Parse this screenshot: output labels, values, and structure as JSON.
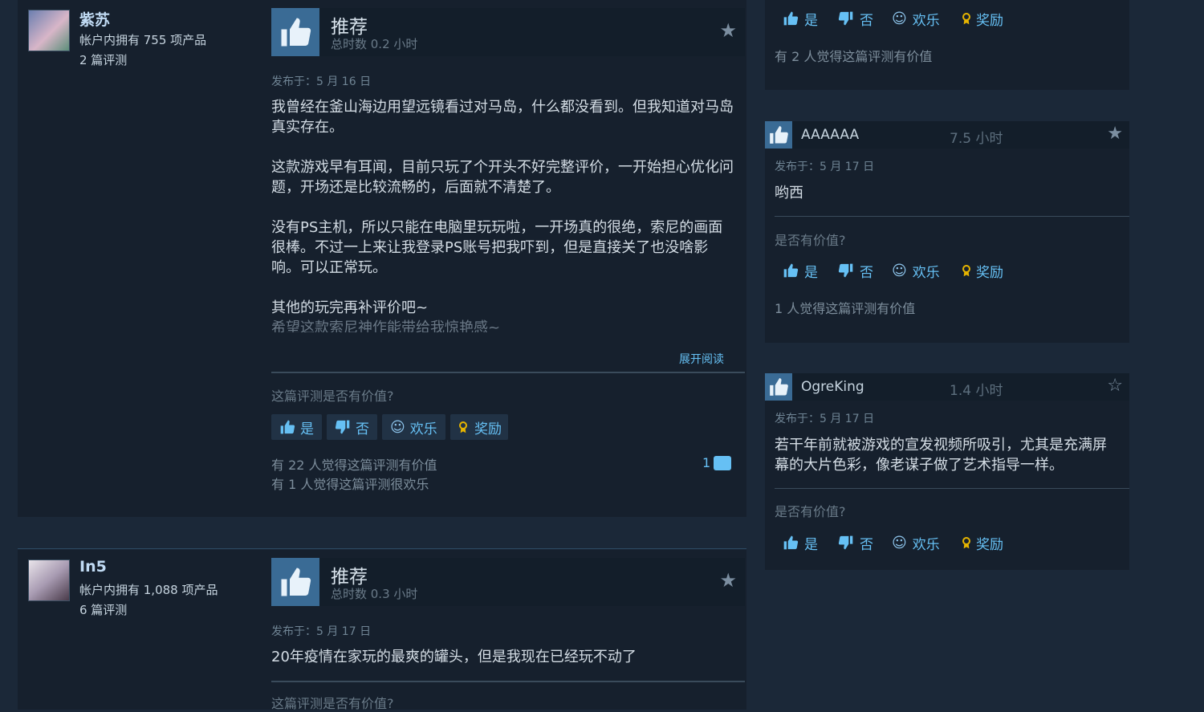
{
  "colors": {
    "accent": "#66c0f4",
    "background": "#1b2838",
    "card": "#16202d",
    "thumb": "#3a6b95"
  },
  "icons": {
    "thumbs_up": "thumbs-up-icon",
    "thumbs_down": "thumbs-down-icon",
    "funny": "smiley-icon",
    "award": "award-icon",
    "star": "star-icon",
    "comment": "comment-icon"
  },
  "review1": {
    "user": {
      "name": "紫苏",
      "products": "帐户内拥有 755 项产品",
      "reviews": "2 篇评测"
    },
    "title": "推荐",
    "hours": "总时数 0.2 小时",
    "posted": "发布于：5 月 16 日",
    "paragraphs": [
      "我曾经在釜山海边用望远镜看过对马岛，什么都没看到。但我知道对马岛真实存在。",
      "这款游戏早有耳闻，目前只玩了个开头不好完整评价，一开始担心优化问题，开场还是比较流畅的，后面就不清楚了。",
      "没有PS主机，所以只能在电脑里玩玩啦，一开场真的很绝，索尼的画面很棒。不过一上来让我登录PS账号把我吓到，但是直接关了也没啥影响。可以正常玩。",
      "其他的玩完再补评价吧~"
    ],
    "faded_line": "希望这款索尼神作能带给我惊艳感~",
    "expand": "展开阅读",
    "question": "这篇评测是否有价值?",
    "btn_yes": "是",
    "btn_no": "否",
    "btn_funny": "欢乐",
    "btn_award": "奖励",
    "helpful": "有 22 人觉得这篇评测有价值",
    "funny": "有 1 人觉得这篇评测很欢乐",
    "comments": "1"
  },
  "review2": {
    "user": {
      "name": "In5",
      "products": "帐户内拥有 1,088 项产品",
      "reviews": "6 篇评测"
    },
    "title": "推荐",
    "hours": "总时数 0.3 小时",
    "posted": "发布于：5 月 17 日",
    "text": "20年疫情在家玩的最爽的罐头，但是我现在已经玩不动了",
    "question": "这篇评测是否有价值?"
  },
  "side0": {
    "btn_yes": "是",
    "btn_no": "否",
    "btn_funny": "欢乐",
    "btn_award": "奖励",
    "helpful": "有 2 人觉得这篇评测有价值"
  },
  "side1": {
    "name": "AAAAAA",
    "hours": "7.5 小时",
    "posted": "发布于：5 月 17 日",
    "text": "哟西",
    "question": "是否有价值?",
    "btn_yes": "是",
    "btn_no": "否",
    "btn_funny": "欢乐",
    "btn_award": "奖励",
    "helpful": "1 人觉得这篇评测有价值"
  },
  "side2": {
    "name": "OgreKing",
    "hours": "1.4 小时",
    "posted": "发布于：5 月 17 日",
    "text": "若干年前就被游戏的宣发视频所吸引，尤其是充满屏幕的大片色彩，像老谋子做了艺术指导一样。",
    "question": "是否有价值?",
    "btn_yes": "是",
    "btn_no": "否",
    "btn_funny": "欢乐",
    "btn_award": "奖励"
  }
}
